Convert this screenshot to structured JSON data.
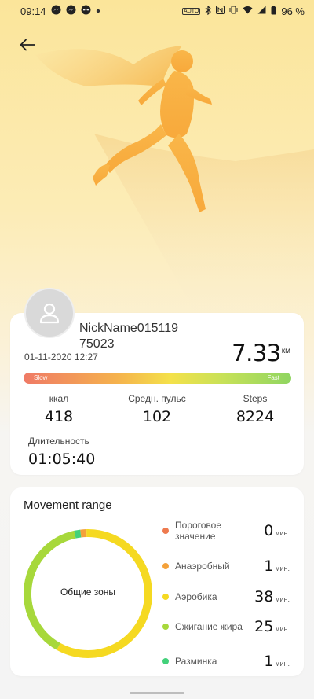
{
  "status_bar": {
    "time": "09:14",
    "battery": "96 %",
    "left_icons": [
      "messenger-icon",
      "messenger-icon",
      "chat-icon",
      "dot-icon"
    ],
    "right_icons": [
      "auto-icon",
      "bluetooth-icon",
      "nfc-icon",
      "vibrate-icon",
      "wifi-icon",
      "signal-icon",
      "battery-icon"
    ]
  },
  "profile": {
    "nickname": "NickName015119",
    "nickname_line2": "75023",
    "datetime": "01-11-2020 12:27"
  },
  "distance": {
    "value": "7.33",
    "unit": "км"
  },
  "speed_bar": {
    "slow": "Slow",
    "fast": "Fast"
  },
  "stats": {
    "kcal": {
      "label": "ккал",
      "value": "418"
    },
    "pulse": {
      "label": "Средн. пульс",
      "value": "102"
    },
    "steps": {
      "label": "Steps",
      "value": "8224"
    }
  },
  "duration": {
    "label": "Длительность",
    "value": "01:05:40"
  },
  "movement": {
    "title": "Movement range",
    "center_label": "Общие зоны",
    "zones": [
      {
        "name": "Пороговое значение",
        "minutes": "0",
        "unit": "мин.",
        "color": "#ee7a4e"
      },
      {
        "name": "Анаэробный",
        "minutes": "1",
        "unit": "мин.",
        "color": "#f4a13a"
      },
      {
        "name": "Аэробика",
        "minutes": "38",
        "unit": "мин.",
        "color": "#f5d921"
      },
      {
        "name": "Сжигание жира",
        "minutes": "25",
        "unit": "мин.",
        "color": "#a7d83b"
      },
      {
        "name": "Разминка",
        "minutes": "1",
        "unit": "мин.",
        "color": "#43d17a"
      }
    ]
  },
  "chart_data": {
    "type": "pie",
    "categories": [
      "Пороговое значение",
      "Анаэробный",
      "Аэробика",
      "Сжигание жира",
      "Разминка"
    ],
    "values": [
      0,
      1,
      38,
      25,
      1
    ],
    "colors": [
      "#ee7a4e",
      "#f4a13a",
      "#f5d921",
      "#a7d83b",
      "#43d17a"
    ],
    "title": "Movement range"
  }
}
